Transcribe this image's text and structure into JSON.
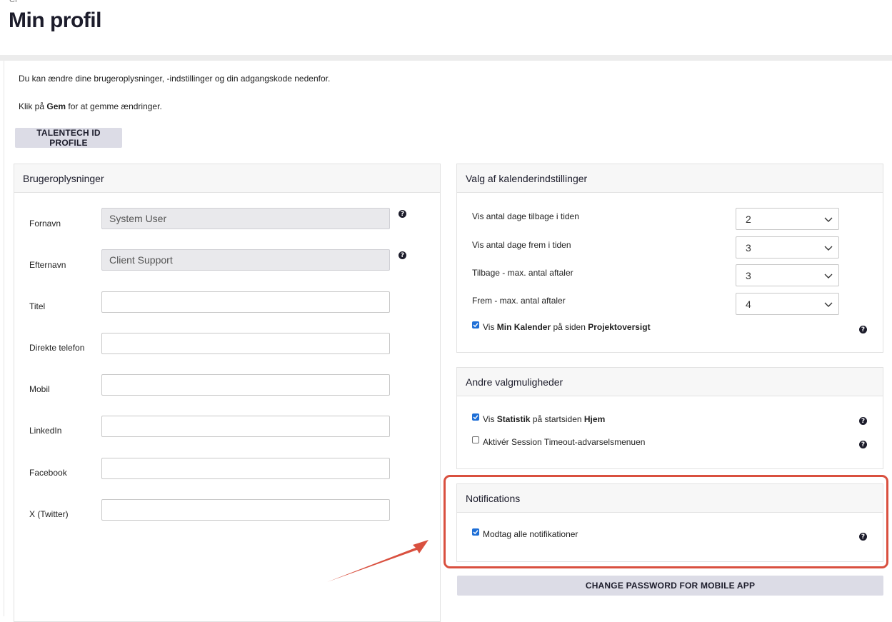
{
  "header": {
    "breadcrumb": "CP",
    "title": "Min profil"
  },
  "intro": {
    "line1": "Du kan ændre dine brugeroplysninger, -indstillinger og din adgangskode nedenfor.",
    "line2_prefix": "Klik på ",
    "line2_bold": "Gem",
    "line2_suffix": " for at gemme ændringer."
  },
  "talentech_button": "TALENTECH ID PROFILE",
  "user_info": {
    "title": "Brugeroplysninger",
    "fields": [
      {
        "label": "Fornavn",
        "value": "System User"
      },
      {
        "label": "Efternavn",
        "value": "Client Support"
      },
      {
        "label": "Titel",
        "value": ""
      },
      {
        "label": "Direkte telefon",
        "value": ""
      },
      {
        "label": "Mobil",
        "value": ""
      },
      {
        "label": "LinkedIn",
        "value": ""
      },
      {
        "label": "Facebook",
        "value": ""
      },
      {
        "label": "X (Twitter)",
        "value": ""
      }
    ]
  },
  "calendar": {
    "title": "Valg af kalenderindstillinger",
    "rows": [
      {
        "label": "Vis antal dage tilbage i tiden",
        "value": "2"
      },
      {
        "label": "Vis antal dage frem i tiden",
        "value": "3"
      },
      {
        "label": "Tilbage - max. antal aftaler",
        "value": "3"
      },
      {
        "label": "Frem - max. antal aftaler",
        "value": "4"
      }
    ],
    "checkbox": {
      "checked": true,
      "pre": "Vis ",
      "bold1": "Min Kalender",
      "mid": " på siden ",
      "bold2": "Projektoversigt"
    }
  },
  "other": {
    "title": "Andre valgmuligheder",
    "statistik": {
      "checked": true,
      "pre": "Vis ",
      "bold1": "Statistik",
      "mid": " på startsiden ",
      "bold2": "Hjem"
    },
    "session": {
      "checked": false,
      "label": "Aktivér Session Timeout-advarselsmenuen"
    }
  },
  "notifications": {
    "title": "Notifications",
    "checkbox": {
      "checked": true,
      "label": "Modtag alle notifikationer"
    }
  },
  "change_password_button": "CHANGE PASSWORD FOR MOBILE APP",
  "colors": {
    "accent_annotation": "#d9503f",
    "checkbox_blue": "#1f6fd6",
    "button_gray": "#dcdce6"
  },
  "help_icon_glyph": "?"
}
